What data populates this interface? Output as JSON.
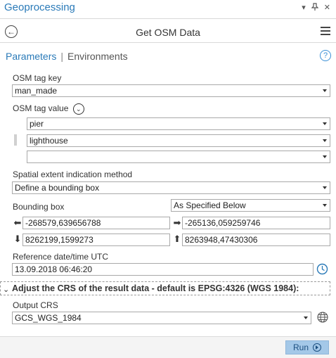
{
  "window": {
    "title": "Geoprocessing",
    "controls": [
      "▾",
      "⊕",
      "✕"
    ]
  },
  "tool": {
    "title": "Get OSM Data"
  },
  "tabs": {
    "parameters": "Parameters",
    "environments": "Environments",
    "separator": "|"
  },
  "params": {
    "tag_key_label": "OSM tag key",
    "tag_key_value": "man_made",
    "tag_value_label": "OSM tag value",
    "tag_values": [
      "pier",
      "lighthouse",
      ""
    ],
    "extent_label": "Spatial extent indication method",
    "extent_value": "Define a bounding box",
    "bbox_label": "Bounding box",
    "bbox_mode": "As Specified Below",
    "bbox_left": "-268579,639656788",
    "bbox_right": "-265136,059259746",
    "bbox_bottom": "8262199,1599273",
    "bbox_top": "8263948,47430306",
    "date_label": "Reference date/time UTC",
    "date_value": "13.09.2018 06:46:20"
  },
  "crs_section": {
    "header": "Adjust the CRS of the result data - default is EPSG:4326 (WGS 1984):",
    "output_label": "Output CRS",
    "output_value": "GCS_WGS_1984"
  },
  "footer": {
    "run_label": "Run"
  },
  "colors": {
    "accent": "#2a7ab8",
    "run_button": "#a4c8e8"
  }
}
